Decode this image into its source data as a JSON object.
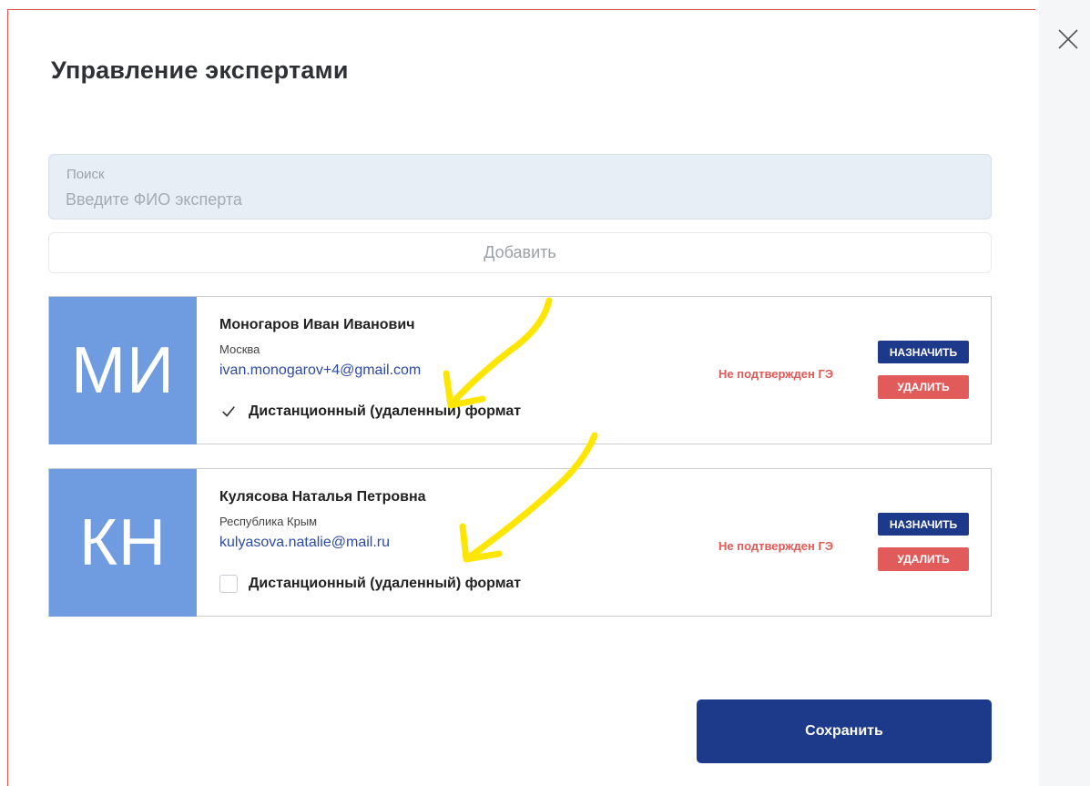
{
  "modal": {
    "title": "Управление экспертами",
    "close_icon": "close-icon"
  },
  "search": {
    "label": "Поиск",
    "placeholder": "Введите ФИО эксперта",
    "value": ""
  },
  "add_button": "Добавить",
  "experts": [
    {
      "initials": "МИ",
      "name": "Моногаров Иван Иванович",
      "city": "Москва",
      "email": "ivan.monogarov+4@gmail.com",
      "remote_label": "Дистанционный (удаленный) формат",
      "remote_checked": true,
      "status": "Не подтвержден ГЭ",
      "assign_label": "НАЗНАЧИТЬ",
      "delete_label": "УДАЛИТЬ"
    },
    {
      "initials": "КН",
      "name": "Кулясова Наталья Петровна",
      "city": "Республика Крым",
      "email": "kulyasova.natalie@mail.ru",
      "remote_label": "Дистанционный (удаленный) формат",
      "remote_checked": false,
      "status": "Не подтвержден ГЭ",
      "assign_label": "НАЗНАЧИТЬ",
      "delete_label": "УДАЛИТЬ"
    }
  ],
  "save_button": "Сохранить",
  "colors": {
    "accent": "#1d3a8a",
    "avatar": "#6f9be0",
    "danger": "#e15b5b",
    "status": "#e05a57",
    "link": "#2e4ba3",
    "annotation_arrow": "#ffe600"
  }
}
